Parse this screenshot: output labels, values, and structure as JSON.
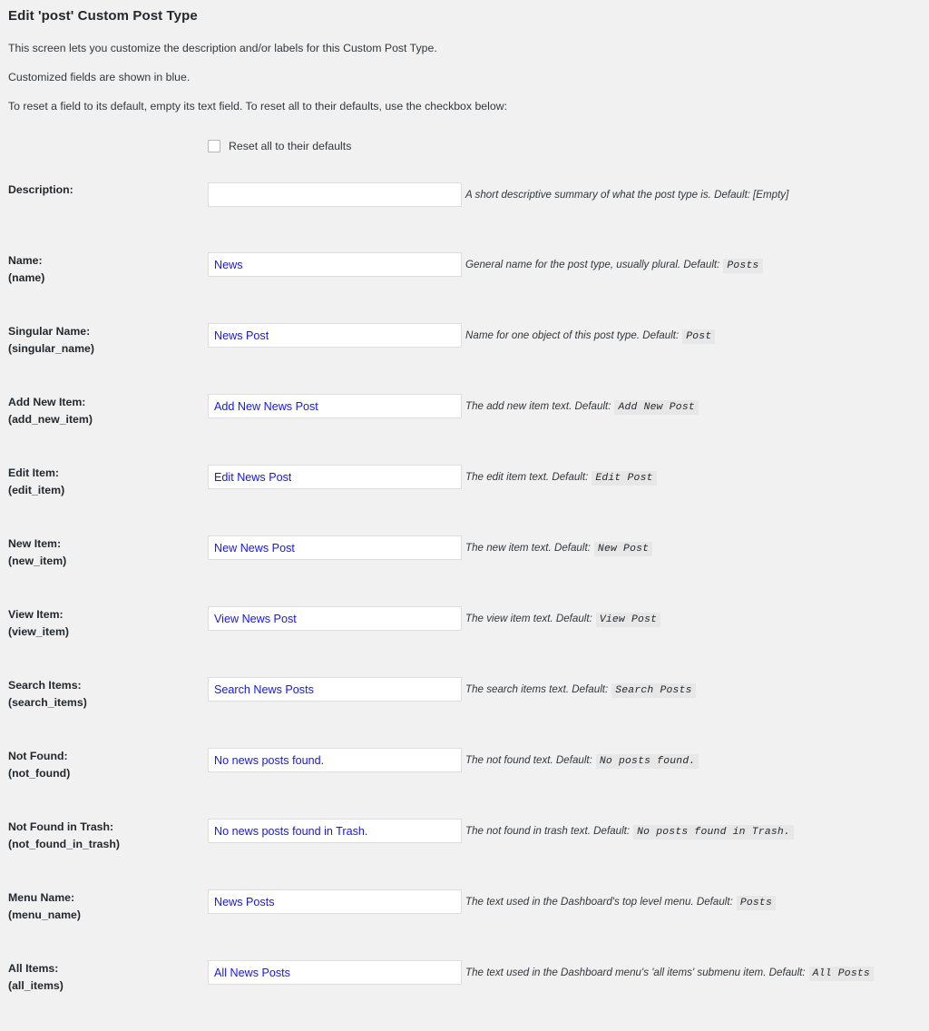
{
  "page": {
    "title": "Edit 'post' Custom Post Type",
    "intro": [
      "This screen lets you customize the description and/or labels for this Custom Post Type.",
      "Customized fields are shown in blue.",
      "To reset a field to its default, empty its text field. To reset all to their defaults, use the checkbox below:"
    ],
    "accent_color": "#1414ff",
    "background_color": "#f1f1f1"
  },
  "reset": {
    "checkbox_checked": false,
    "label": "Reset all to their defaults"
  },
  "rows": [
    {
      "label": "Description:",
      "key": "",
      "value": "",
      "placeholder": "",
      "hint": "A short descriptive summary of what the post type is. Default:",
      "default": "[Empty]",
      "default_is_code": false
    },
    {
      "label": "Name:",
      "key": "(name)",
      "value": "News",
      "placeholder": "",
      "hint": "General name for the post type, usually plural. Default:",
      "default": "Posts",
      "default_is_code": true
    },
    {
      "label": "Singular Name:",
      "key": "(singular_name)",
      "value": "News Post",
      "placeholder": "",
      "hint": "Name for one object of this post type. Default:",
      "default": "Post",
      "default_is_code": true
    },
    {
      "label": "Add New Item:",
      "key": "(add_new_item)",
      "value": "Add New News Post",
      "placeholder": "",
      "hint": "The add new item text. Default:",
      "default": "Add New Post",
      "default_is_code": true
    },
    {
      "label": "Edit Item:",
      "key": "(edit_item)",
      "value": "Edit News Post",
      "placeholder": "",
      "hint": "The edit item text. Default:",
      "default": "Edit Post",
      "default_is_code": true
    },
    {
      "label": "New Item:",
      "key": "(new_item)",
      "value": "New News Post",
      "placeholder": "",
      "hint": "The new item text. Default:",
      "default": "New Post",
      "default_is_code": true
    },
    {
      "label": "View Item:",
      "key": "(view_item)",
      "value": "View News Post",
      "placeholder": "",
      "hint": "The view item text. Default:",
      "default": "View Post",
      "default_is_code": true
    },
    {
      "label": "Search Items:",
      "key": "(search_items)",
      "value": "Search News Posts",
      "placeholder": "",
      "hint": "The search items text. Default:",
      "default": "Search Posts",
      "default_is_code": true
    },
    {
      "label": "Not Found:",
      "key": "(not_found)",
      "value": "No news posts found.",
      "placeholder": "",
      "hint": "The not found text. Default:",
      "default": "No posts found.",
      "default_is_code": true
    },
    {
      "label": "Not Found in Trash:",
      "key": "(not_found_in_trash)",
      "value": "No news posts found in Trash.",
      "placeholder": "",
      "hint": "The not found in trash text. Default:",
      "default": "No posts found in Trash.",
      "default_is_code": true
    },
    {
      "label": "Menu Name:",
      "key": "(menu_name)",
      "value": "News Posts",
      "placeholder": "",
      "hint": "The text used in the Dashboard's top level menu. Default:",
      "default": "Posts",
      "default_is_code": true
    },
    {
      "label": "All Items:",
      "key": "(all_items)",
      "value": "All News Posts",
      "placeholder": "",
      "hint": "The text used in the Dashboard menu's 'all items' submenu item. Default:",
      "default": "All Posts",
      "default_is_code": true
    }
  ]
}
